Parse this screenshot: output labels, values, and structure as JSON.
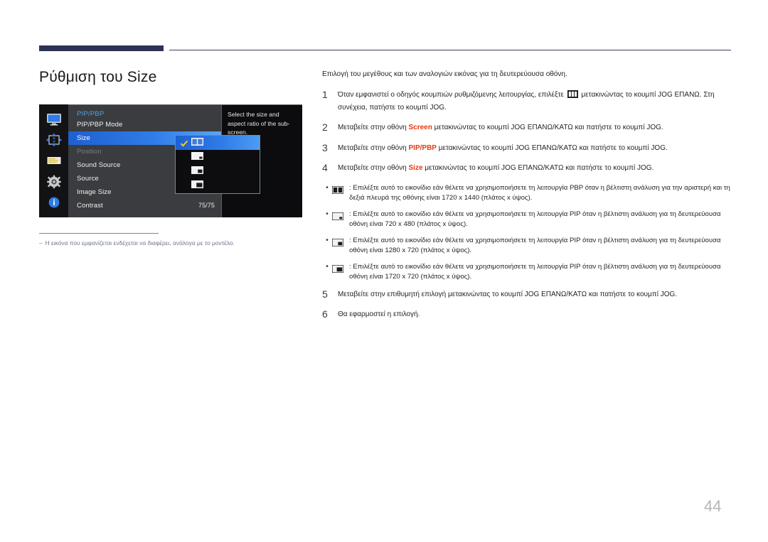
{
  "page": {
    "title": "Ρύθμιση του Size",
    "number": "44"
  },
  "osd": {
    "rail_icons": [
      "monitor-icon",
      "pip-position-icon",
      "onscreen-display-icon",
      "system-gear-icon",
      "information-icon"
    ],
    "menu_header": "PIP/PBP",
    "items": [
      {
        "label": "PIP/PBP Mode",
        "value": "",
        "state": "normal"
      },
      {
        "label": "Size",
        "value": "",
        "state": "selected"
      },
      {
        "label": "Position",
        "value": "",
        "state": "disabled"
      },
      {
        "label": "Sound Source",
        "value": "",
        "state": "normal"
      },
      {
        "label": "Source",
        "value": "",
        "state": "normal"
      },
      {
        "label": "Image Size",
        "value": "",
        "state": "submenu"
      },
      {
        "label": "Contrast",
        "value": "75/75",
        "state": "normal"
      }
    ],
    "popup_options": [
      {
        "icon": "pbp-half-half-icon",
        "checked": true
      },
      {
        "icon": "pip-small-icon",
        "checked": false
      },
      {
        "icon": "pip-medium-icon",
        "checked": false
      },
      {
        "icon": "pip-large-icon",
        "checked": false
      }
    ],
    "help_text": "Select the size and aspect ratio of the sub-screen.",
    "colors": {
      "highlight": "#2f7ce8",
      "header_text": "#4fa3e3",
      "check": "#ffd400",
      "background": "#3a3c3f",
      "panel": "#0c0c0e"
    }
  },
  "footnote": {
    "dash": "‒",
    "text": "Η εικόνα που εμφανίζεται ενδέχεται να διαφέρει, ανάλογα με το μοντέλο."
  },
  "content": {
    "intro": "Επιλογή του μεγέθους και των αναλογιών εικόνας για τη δευτερεύουσα οθόνη.",
    "steps": [
      {
        "num": "1",
        "pre": "Όταν εμφανιστεί ο οδηγός κουμπιών ρυθμιζόμενης λειτουργίας, επιλέξτε",
        "icon": "pip-pbp-jog-guide-icon",
        "post": "μετακινώντας το κουμπί JOG ΕΠΑΝΩ. Στη συνέχεια, πατήστε το κουμπί JOG."
      },
      {
        "num": "2",
        "pre": "Μεταβείτε στην οθόνη",
        "highlight": "Screen",
        "post": "μετακινώντας το κουμπί JOG ΕΠΑΝΩ/ΚΑΤΩ και πατήστε το κουμπί JOG."
      },
      {
        "num": "3",
        "pre": "Μεταβείτε στην οθόνη",
        "highlight": "PIP/PBP",
        "post": "μετακινώντας το κουμπί JOG ΕΠΑΝΩ/ΚΑΤΩ και πατήστε το κουμπί JOG."
      },
      {
        "num": "4",
        "pre": "Μεταβείτε στην οθόνη",
        "highlight": "Size",
        "post": "μετακινώντας το κουμπί JOG ΕΠΑΝΩ/ΚΑΤΩ και πατήστε το κουμπί JOG."
      }
    ],
    "bullets": [
      {
        "dot": "•",
        "icon": "pbp-half-half-icon",
        "text": ": Επιλέξτε αυτό το εικονίδιο εάν θέλετε να χρησιμοποιήσετε τη λειτουργία PBP όταν η βέλτιστη ανάλυση για την αριστερή και τη δεξιά πλευρά της οθόνης είναι 1720 x 1440 (πλάτος x ύψος)."
      },
      {
        "dot": "•",
        "icon": "pip-small-icon",
        "text": ": Επιλέξτε αυτό το εικονίδιο εάν θέλετε να χρησιμοποιήσετε τη λειτουργία PIP όταν η βέλτιστη ανάλυση για τη δευτερεύουσα οθόνη είναι 720 x 480 (πλάτος x ύψος)."
      },
      {
        "dot": "•",
        "icon": "pip-medium-icon",
        "text": ": Επιλέξτε αυτό το εικονίδιο εάν θέλετε να χρησιμοποιήσετε τη λειτουργία PIP όταν η βέλτιστη ανάλυση για τη δευτερεύουσα οθόνη είναι 1280 x 720 (πλάτος x ύψος)."
      },
      {
        "dot": "•",
        "icon": "pip-large-icon",
        "text": ": Επιλέξτε αυτό το εικονίδιο εάν θέλετε να χρησιμοποιήσετε τη λειτουργία PIP όταν η βέλτιστη ανάλυση για τη δευτερεύουσα οθόνη είναι 1720 x 720 (πλάτος x ύψος)."
      }
    ],
    "steps_tail": [
      {
        "num": "5",
        "text": "Μεταβείτε στην επιθυμητή επιλογή μετακινώντας το κουμπί JOG ΕΠΑΝΩ/ΚΑΤΩ και πατήστε το κουμπί JOG."
      },
      {
        "num": "6",
        "text": "Θα εφαρμοστεί η επιλογή."
      }
    ]
  }
}
